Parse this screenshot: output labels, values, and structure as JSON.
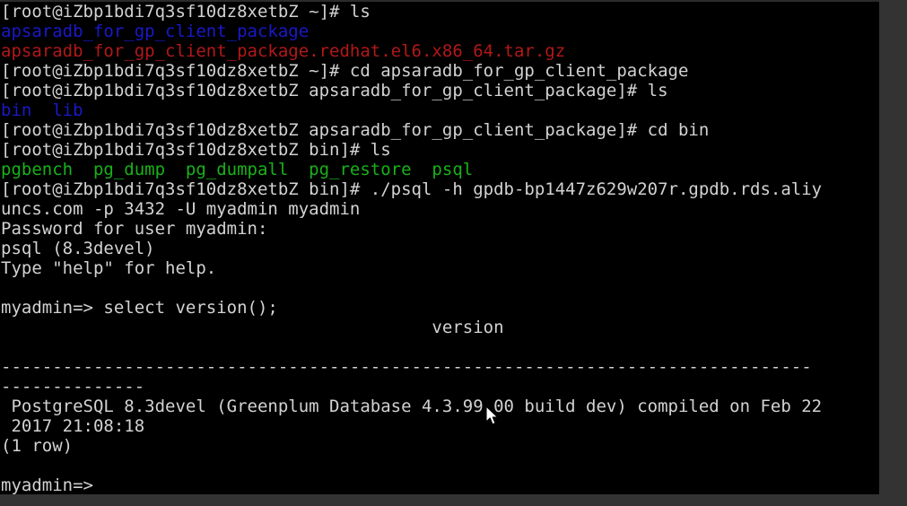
{
  "terminal": {
    "colors": {
      "background": "#000000",
      "foreground": "#d2d2d2",
      "blue": "#1919c8",
      "red": "#b21818",
      "green": "#18b218",
      "frame": "#333333"
    },
    "prompt_user_host": "[root@iZbp1bdi7q3sf10dz8xetbZ",
    "psql_prompt": "myadmin=>",
    "lines": [
      {
        "id": "line-1",
        "color": "default",
        "text": "[root@iZbp1bdi7q3sf10dz8xetbZ ~]# ls"
      },
      {
        "id": "line-2",
        "color": "blue",
        "text": "apsaradb_for_gp_client_package"
      },
      {
        "id": "line-3",
        "color": "red",
        "text": "apsaradb_for_gp_client_package.redhat.el6.x86_64.tar.gz"
      },
      {
        "id": "line-4",
        "color": "default",
        "text": "[root@iZbp1bdi7q3sf10dz8xetbZ ~]# cd apsaradb_for_gp_client_package"
      },
      {
        "id": "line-5",
        "color": "default",
        "text": "[root@iZbp1bdi7q3sf10dz8xetbZ apsaradb_for_gp_client_package]# ls"
      },
      {
        "id": "line-6",
        "color": "blue",
        "text": "bin  lib"
      },
      {
        "id": "line-7",
        "color": "default",
        "text": "[root@iZbp1bdi7q3sf10dz8xetbZ apsaradb_for_gp_client_package]# cd bin"
      },
      {
        "id": "line-8",
        "color": "default",
        "text": "[root@iZbp1bdi7q3sf10dz8xetbZ bin]# ls"
      },
      {
        "id": "line-9",
        "color": "green",
        "text": "pgbench  pg_dump  pg_dumpall  pg_restore  psql"
      },
      {
        "id": "line-10",
        "color": "default",
        "text": "[root@iZbp1bdi7q3sf10dz8xetbZ bin]# ./psql -h gpdb-bp1447z629w207r.gpdb.rds.aliy"
      },
      {
        "id": "line-11",
        "color": "default",
        "text": "uncs.com -p 3432 -U myadmin myadmin"
      },
      {
        "id": "line-12",
        "color": "default",
        "text": "Password for user myadmin:"
      },
      {
        "id": "line-13",
        "color": "default",
        "text": "psql (8.3devel)"
      },
      {
        "id": "line-14",
        "color": "default",
        "text": "Type \"help\" for help."
      },
      {
        "id": "line-15",
        "color": "default",
        "text": ""
      },
      {
        "id": "line-16",
        "color": "default",
        "text": "myadmin=> select version();"
      },
      {
        "id": "line-17",
        "color": "default",
        "text": "                                          version"
      },
      {
        "id": "line-18",
        "color": "default",
        "text": ""
      },
      {
        "id": "line-19",
        "color": "default",
        "text": "-------------------------------------------------------------------------------"
      },
      {
        "id": "line-20",
        "color": "default",
        "text": "--------------"
      },
      {
        "id": "line-21",
        "color": "default",
        "text": " PostgreSQL 8.3devel (Greenplum Database 4.3.99.00 build dev) compiled on Feb 22"
      },
      {
        "id": "line-22",
        "color": "default",
        "text": " 2017 21:08:18"
      },
      {
        "id": "line-23",
        "color": "default",
        "text": "(1 row)"
      },
      {
        "id": "line-24",
        "color": "default",
        "text": ""
      },
      {
        "id": "line-25",
        "color": "default",
        "text": "myadmin=>"
      }
    ],
    "commands": [
      "ls",
      "cd apsaradb_for_gp_client_package",
      "ls",
      "cd bin",
      "ls",
      "./psql -h gpdb-bp1447z629w207r.gpdb.rds.aliyuncs.com -p 3432 -U myadmin myadmin",
      "select version();"
    ],
    "query_result": {
      "column": "version",
      "value": "PostgreSQL 8.3devel (Greenplum Database 4.3.99.00 build dev) compiled on Feb 22 2017 21:08:18",
      "row_count": "(1 row)"
    },
    "connection": {
      "host": "gpdb-bp1447z629w207r.gpdb.rds.aliyuncs.com",
      "port": "3432",
      "user": "myadmin",
      "database": "myadmin"
    },
    "mouse_cursor": {
      "name": "mouse-pointer",
      "x": "548",
      "y": "462"
    }
  }
}
